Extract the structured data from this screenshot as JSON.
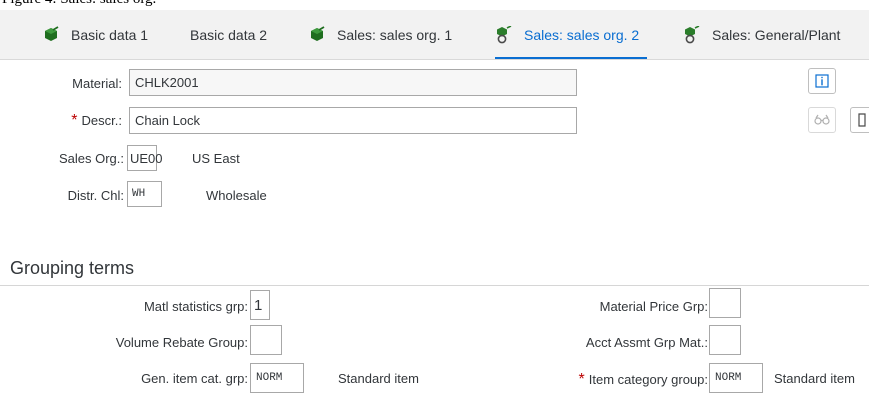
{
  "caption": "Figure 4: Sales: sales org.",
  "tabs": [
    {
      "label": "Basic data 1",
      "icon": "checked-cube-icon"
    },
    {
      "label": "Basic data 2",
      "icon": ""
    },
    {
      "label": "Sales: sales org. 1",
      "icon": "checked-cube-icon"
    },
    {
      "label": "Sales: sales org. 2",
      "icon": "cube-ring-icon",
      "active": true
    },
    {
      "label": "Sales: General/Plant",
      "icon": "cube-ring-icon"
    }
  ],
  "header": {
    "material_label": "Material:",
    "material_value": "CHLK2001",
    "descr_required": "*",
    "descr_label": "Descr.:",
    "descr_value": "Chain Lock",
    "sales_org_label": "Sales Org.:",
    "sales_org_value": "UE00",
    "sales_org_text": "US East",
    "distr_chl_label": "Distr. Chl:",
    "distr_chl_value": "WH",
    "distr_chl_text": "Wholesale"
  },
  "grouping": {
    "title": "Grouping terms",
    "matl_stat_label": "Matl statistics grp:",
    "matl_stat_value": "1",
    "volume_rebate_label": "Volume Rebate Group:",
    "volume_rebate_value": "",
    "gen_item_cat_label": "Gen. item cat. grp:",
    "gen_item_cat_value": "NORM",
    "gen_item_cat_text": "Standard item",
    "mat_price_label": "Material Price Grp:",
    "mat_price_value": "",
    "acct_assmt_label": "Acct Assmt Grp Mat.:",
    "acct_assmt_value": "",
    "item_cat_required": "*",
    "item_cat_label": "Item category group:",
    "item_cat_value": "NORM",
    "item_cat_text": "Standard item"
  },
  "colors": {
    "accent": "#0a6ed1",
    "icon_green": "#2b7d2b",
    "required": "#bb0000"
  }
}
